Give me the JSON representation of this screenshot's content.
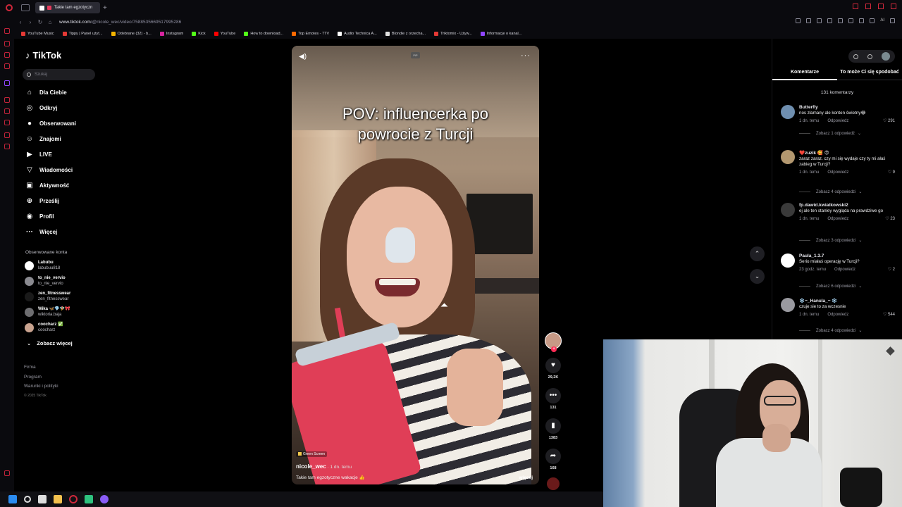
{
  "browser": {
    "tab_title": "Takie tam egzotyczn",
    "url_host": "www.tiktok.com",
    "url_path": "/@nicole_wec/video/7588535669517995286",
    "ai_label": "AI"
  },
  "bookmarks": [
    {
      "label": "YouTube Music",
      "color": "#e53935"
    },
    {
      "label": "Tippy | Panel użyt...",
      "color": "#e53935"
    },
    {
      "label": "Odebrane (32) - b...",
      "color": "#f4b400"
    },
    {
      "label": "Instagram",
      "color": "#d6249f"
    },
    {
      "label": "Kick",
      "color": "#53fc18"
    },
    {
      "label": "YouTube",
      "color": "#ff0000"
    },
    {
      "label": "How to download...",
      "color": "#53fc18"
    },
    {
      "label": "Top Emotes - 7TV",
      "color": "#ff6a00"
    },
    {
      "label": "Audio Technica A...",
      "color": "#ffffff"
    },
    {
      "label": "Blondie z orzecha...",
      "color": "#e0e0e0"
    },
    {
      "label": "Triktomix - Używ...",
      "color": "#e53935"
    },
    {
      "label": "Informacje o kanal...",
      "color": "#9146ff"
    }
  ],
  "tiktok": {
    "logo": "TikTok",
    "search_placeholder": "Szukaj",
    "nav": [
      {
        "label": "Dla Ciebie",
        "icon": "home-icon"
      },
      {
        "label": "Odkryj",
        "icon": "compass-icon"
      },
      {
        "label": "Obserwowani",
        "icon": "following-icon"
      },
      {
        "label": "Znajomi",
        "icon": "friends-icon"
      },
      {
        "label": "LIVE",
        "icon": "live-icon"
      },
      {
        "label": "Wiadomości",
        "icon": "messages-icon"
      },
      {
        "label": "Aktywność",
        "icon": "activity-icon"
      },
      {
        "label": "Prześlij",
        "icon": "upload-icon"
      },
      {
        "label": "Profil",
        "icon": "profile-icon"
      },
      {
        "label": "Więcej",
        "icon": "more-icon"
      }
    ],
    "followed_title": "Obserwowane konta",
    "followed": [
      {
        "name": "Labubu",
        "handle": "labubuu818",
        "color": "#ffffff"
      },
      {
        "name": "to_nie_vervio",
        "handle": "to_nie_vervio",
        "color": "#8a8a90"
      },
      {
        "name": "zen_fitnesswear",
        "handle": "zen_fitnesswear",
        "color": "#1a1a1a"
      },
      {
        "name": "Wika 🦋💎🧚‍♀️🎀",
        "handle": "wiktoria.baja",
        "color": "#6d6d70"
      },
      {
        "name": "coocharz ✅",
        "handle": "coocharz",
        "color": "#c9a38f"
      }
    ],
    "see_more": "Zobacz więcej",
    "footer": [
      "Firma",
      "Program",
      "Warunki i polityki"
    ],
    "copyright": "© 2025 TikTok"
  },
  "video": {
    "caption_line1": "POV: influencerka po",
    "caption_line2": "powrocie z Turcji",
    "badge": "Green Screen",
    "author": "nicole_wec",
    "time": " · 1 dn. temu",
    "description": "Takie tam egzotyczne wakacje 👍",
    "more": "więcej",
    "pip_label": "PiP"
  },
  "actions": {
    "likes": "29,2K",
    "comments": "131",
    "saves": "1383",
    "shares": "168"
  },
  "comments_panel": {
    "tab_comments": "Komentarze",
    "tab_suggested": "To może Ci się spodobać",
    "count": "131 komentarzy",
    "items": [
      {
        "user": "Butterfly",
        "text": "nos złamany ale konten świetny😂",
        "time": "1 dn. temu",
        "reply": "Odpowiedz",
        "likes": "291",
        "replies": "Zobacz 1 odpowiedź",
        "avatar": "#6f8fb0"
      },
      {
        "user": "❤️zuzik 🥰 😍",
        "text": "zaraz zaraz. czy mi się wydaje czy ty mi ałaś zabieg w Turcji?",
        "time": "1 dn. temu",
        "reply": "Odpowiedz",
        "likes": "9",
        "replies": "Zobacz 4 odpowiedzi",
        "avatar": "#b39870"
      },
      {
        "user": "fp.dawid.kwiatkowski2",
        "text": "ej ale ten stanley wygląda na prawdziwe go",
        "time": "1 dn. temu",
        "reply": "Odpowiedz",
        "likes": "23",
        "replies": "Zobacz 3 odpowiedzi",
        "avatar": "#3a3a3a"
      },
      {
        "user": "Paula_1.3.7",
        "text": "Serio miałaś operację w Turcji?",
        "time": "23 godz. temu",
        "reply": "Odpowiedz",
        "likes": "2",
        "replies": "Zobacz 6 odpowiedzi",
        "avatar": "#ffffff"
      },
      {
        "user": "❄️~_Hanula_~ ❄️",
        "text": "czuje sie to za wczesnie",
        "time": "1 dn. temu",
        "reply": "Odpowiedz",
        "likes": "544",
        "replies": "Zobacz 4 odpowiedzi",
        "avatar": "#9a9aa0"
      }
    ]
  },
  "colors": {
    "tiktok_red": "#fe2c55",
    "opera_red": "#d0283b"
  }
}
